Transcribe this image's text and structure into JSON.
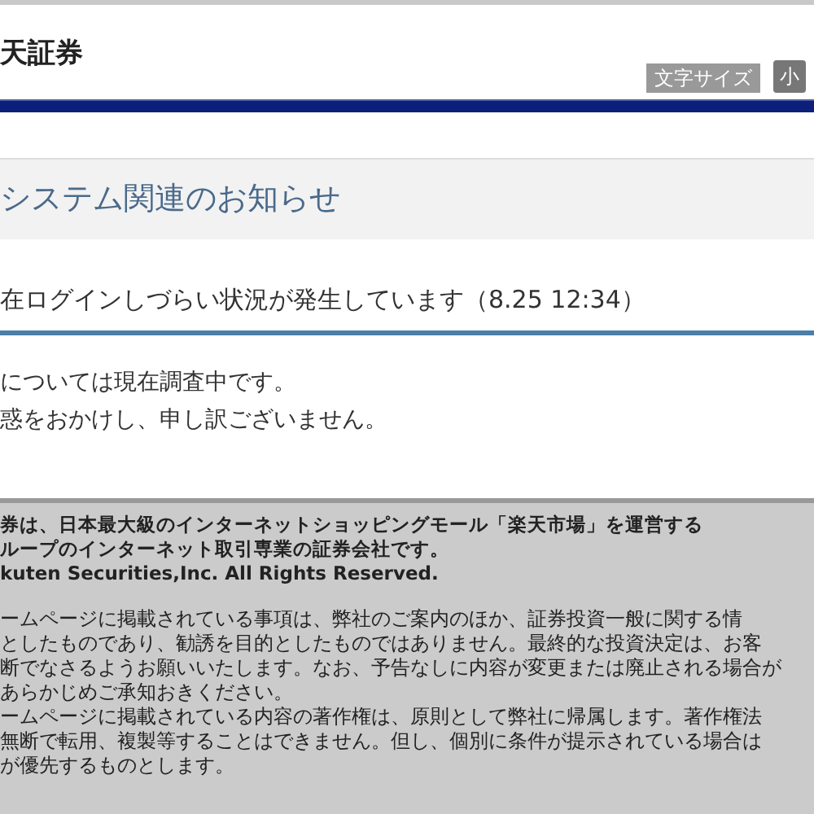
{
  "header": {
    "logo": "天証券",
    "font_size_label": "文字サイズ",
    "font_size_options": [
      {
        "label": "小",
        "selected": true
      }
    ]
  },
  "section_title": "システム関連のお知らせ",
  "notice": {
    "headline": "在ログインしづらい状況が発生しています（8.25 12:34）",
    "body": [
      "については現在調査中です。",
      "惑をおかけし、申し訳ございません。"
    ]
  },
  "footer": {
    "company_lines": [
      "券は、日本最大級のインターネットショッピングモール「楽天市場」を運営する",
      "ループのインターネット取引専業の証券会社です。",
      "kuten Securities,Inc. All Rights Reserved."
    ],
    "disclaimer_lines": [
      "ームページに掲載されている事項は、弊社のご案内のほか、証券投資一般に関する情",
      "としたものであり、勧誘を目的としたものではありません。最終的な投資決定は、お客",
      "断でなさるようお願いいたします。なお、予告なしに内容が変更または廃止される場合が",
      "あらかじめご承知おきください。",
      "ームページに掲載されている内容の著作権は、原則として弊社に帰属します。著作権法",
      "無断で転用、複製等することはできません。但し、個別に条件が提示されている場合は",
      "が優先するものとします。"
    ]
  }
}
